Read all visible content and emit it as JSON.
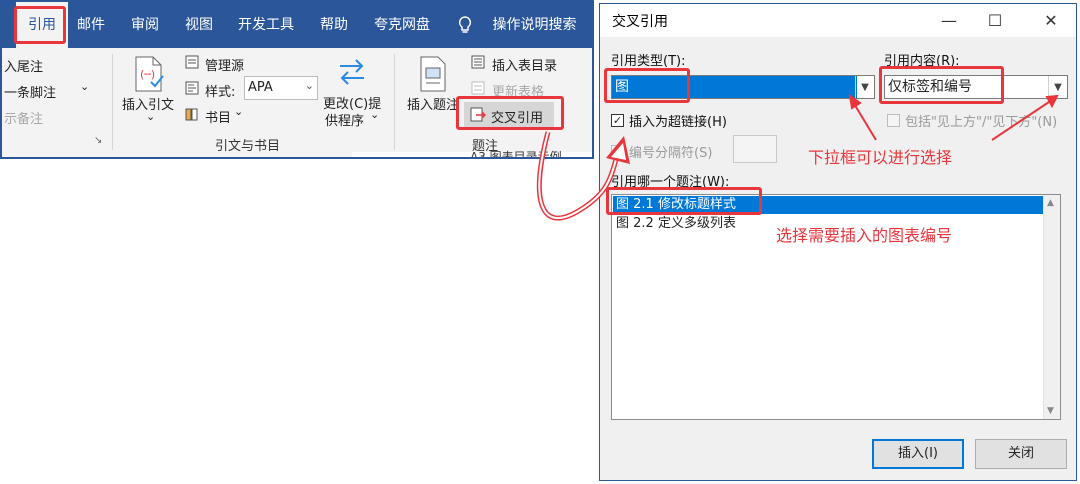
{
  "ribbon": {
    "tabs": [
      "引用",
      "邮件",
      "审阅",
      "视图",
      "开发工具",
      "帮助",
      "夸克网盘"
    ],
    "tell_me": "操作说明搜索",
    "footnotes": {
      "insert_endnote": "入尾注",
      "next_footnote": "一条脚注",
      "show_notes": "示备注"
    },
    "citations": {
      "insert_citation": "插入引文",
      "manage_sources": "管理源",
      "style_label": "样式:",
      "style_value": "APA",
      "bibliography": "书目",
      "update_tool": "更改(C)提",
      "update_tool_line2": "供程序",
      "group_label": "引文与书目"
    },
    "captions": {
      "insert_caption": "插入题注",
      "insert_table_of_figures": "插入表目录",
      "update_table": "更新表格",
      "cross_reference": "交叉引用",
      "group_label": "题注"
    },
    "doc_snippet": "A3.图表目录示例"
  },
  "dialog": {
    "title": "交叉引用",
    "reference_type_label": "引用类型(T):",
    "reference_type_value": "图",
    "insert_reference_to_label": "引用内容(R):",
    "insert_reference_to_value": "仅标签和编号",
    "insert_as_hyperlink": "插入为超链接(H)",
    "include_above_below": "包括\"见上方\"/\"见下方\"(N)",
    "separate_numbers": "编号分隔符(S)",
    "for_which_caption_label": "引用哪一个题注(W):",
    "captions": [
      "图 2.1 修改标题样式",
      "图 2.2 定义多级列表"
    ],
    "insert_button": "插入(I)",
    "close_button": "关闭"
  },
  "annotations": {
    "dropdown_hint": "下拉框可以进行选择",
    "select_hint": "选择需要插入的图表编号"
  },
  "colors": {
    "accent": "#2b579a",
    "highlight": "#e8363d",
    "selection": "#0078d7"
  }
}
